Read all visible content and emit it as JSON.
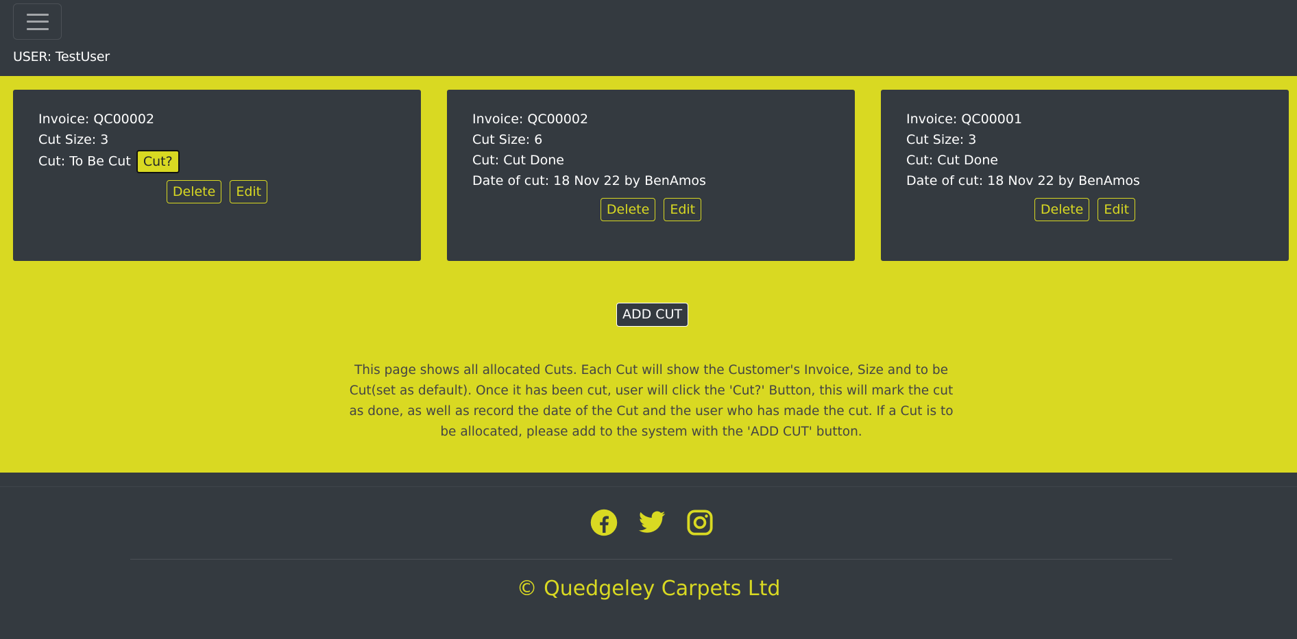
{
  "user": {
    "label": "USER: TestUser"
  },
  "cards": [
    {
      "invoice": "Invoice: QC00002",
      "size": "Cut Size: 3",
      "status": "Cut: To Be Cut",
      "cut_button": "Cut?",
      "delete_label": "Delete",
      "edit_label": "Edit"
    },
    {
      "invoice": "Invoice: QC00002",
      "size": "Cut Size: 6",
      "status": "Cut: Cut Done",
      "date": "Date of cut: 18 Nov 22 by BenAmos",
      "delete_label": "Delete",
      "edit_label": "Edit"
    },
    {
      "invoice": "Invoice: QC00001",
      "size": "Cut Size: 3",
      "status": "Cut: Cut Done",
      "date": "Date of cut: 18 Nov 22 by BenAmos",
      "delete_label": "Delete",
      "edit_label": "Edit"
    }
  ],
  "add_cut_label": "ADD CUT",
  "description": "This page shows all allocated Cuts. Each Cut will show the Customer's Invoice, Size and to be Cut(set as default). Once it has been cut, user will click the 'Cut?' Button, this will mark the cut as done, as well as record the date of the Cut and the user who has made the cut. If a Cut is to be allocated, please add to the system with the 'ADD CUT' button.",
  "footer": {
    "icons": [
      "facebook-icon",
      "twitter-icon",
      "instagram-icon"
    ],
    "copyright": "© Quedgeley Carpets Ltd"
  },
  "colors": {
    "accent": "#d9d922",
    "dark": "#343a40"
  }
}
